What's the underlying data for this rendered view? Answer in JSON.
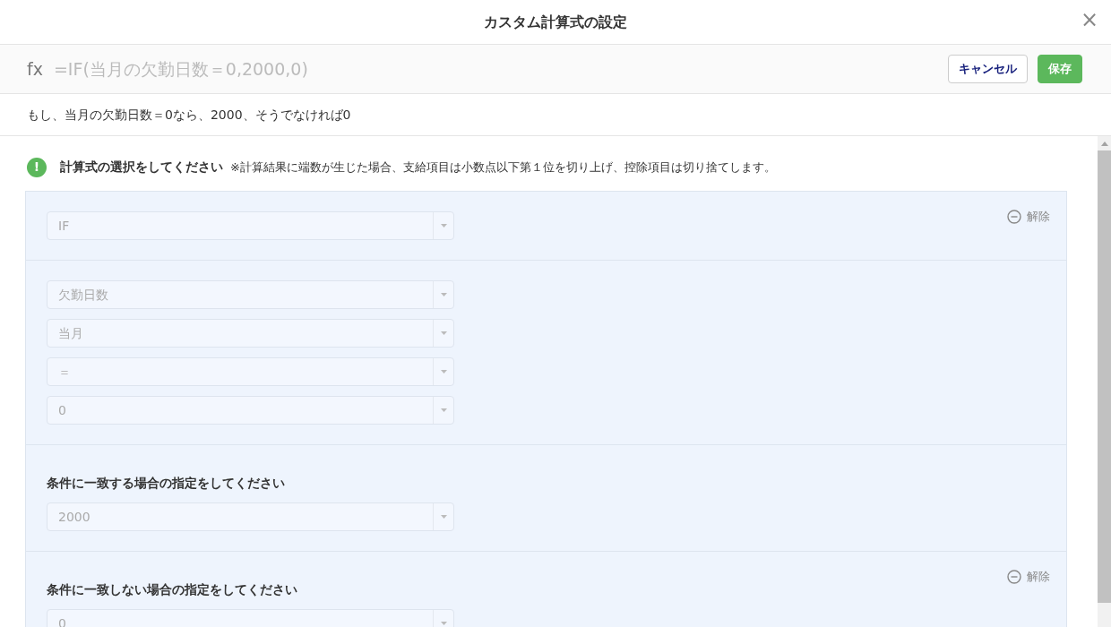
{
  "dialog": {
    "title": "カスタム計算式の設定",
    "close": "×"
  },
  "formula_bar": {
    "prefix": "fx",
    "formula": "=IF(当月の欠勤日数＝0,2000,0)",
    "buttons": [
      {
        "kind": "secondary",
        "label": "キャンセル"
      },
      {
        "kind": "primary",
        "label": "保存"
      }
    ]
  },
  "description": "もし、当月の欠勤日数＝0なら、2000、そうでなければ0",
  "notice": {
    "icon": "!",
    "title": "計算式の選択をしてください",
    "note": "※計算結果に端数が生じた場合、支給項目は小数点以下第１位を切り上げ、控除項目は切り捨てします。"
  },
  "sections": [
    {
      "remove": "解除",
      "selects": [
        "IF"
      ]
    },
    {
      "selects": [
        "欠勤日数",
        "当月",
        "＝",
        "0"
      ]
    },
    {
      "label": "条件に一致する場合の指定をしてください",
      "selects": [
        "2000"
      ]
    },
    {
      "label": "条件に一致しない場合の指定をしてください",
      "remove": "解除",
      "selects": [
        "0"
      ]
    }
  ]
}
